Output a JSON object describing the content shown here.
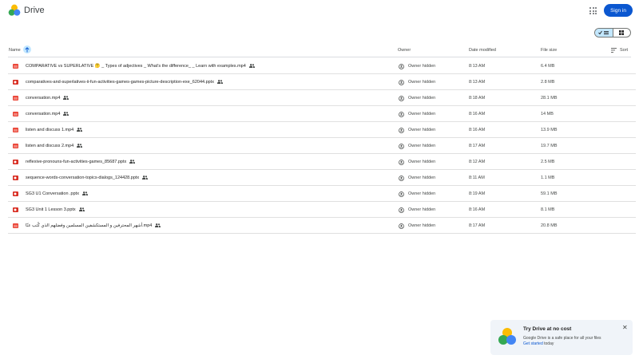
{
  "header": {
    "brand": "Drive",
    "signin_label": "Sign in"
  },
  "columns": {
    "name": "Name",
    "owner": "Owner",
    "date": "Date modified",
    "size": "File size",
    "sort": "Sort"
  },
  "files": [
    {
      "name": "COMPARATIVE vs SUPERLATIVE 🤔 _ Types of adjectives _ What's the difference_ _ Learn with examples.mp4",
      "type": "mp4",
      "owner": "Owner hidden",
      "date": "8:13 AM",
      "size": "6.4 MB"
    },
    {
      "name": "comparatives-and-superlatives-ii-fun-activities-games-games-picture-description-exe_62044.pptx",
      "type": "pptx",
      "owner": "Owner hidden",
      "date": "8:13 AM",
      "size": "2.8 MB"
    },
    {
      "name": "conversation.mp4",
      "type": "mp4",
      "owner": "Owner hidden",
      "date": "8:18 AM",
      "size": "28.1 MB"
    },
    {
      "name": "conversation.mp4",
      "type": "mp4",
      "owner": "Owner hidden",
      "date": "8:16 AM",
      "size": "14 MB"
    },
    {
      "name": "listen and discuss 1.mp4",
      "type": "mp4",
      "owner": "Owner hidden",
      "date": "8:16 AM",
      "size": "13.9 MB"
    },
    {
      "name": "listen and discuss 2.mp4",
      "type": "mp4",
      "owner": "Owner hidden",
      "date": "8:17 AM",
      "size": "19.7 MB"
    },
    {
      "name": "reflexive-pronouns-fun-activities-games_85687.pptx",
      "type": "pptx",
      "owner": "Owner hidden",
      "date": "8:12 AM",
      "size": "2.5 MB"
    },
    {
      "name": "sequence-words-conversation-topics-dialogs_124428.pptx",
      "type": "pptx",
      "owner": "Owner hidden",
      "date": "8:11 AM",
      "size": "1.1 MB"
    },
    {
      "name": "SG3 U1 Conversation .pptx",
      "type": "pptx",
      "owner": "Owner hidden",
      "date": "8:19 AM",
      "size": "59.1 MB"
    },
    {
      "name": "SG3 Unit 1 Lesson 3.pptx",
      "type": "pptx",
      "owner": "Owner hidden",
      "date": "8:16 AM",
      "size": "8.1 MB"
    },
    {
      "name": "أشهر المحترفين و المستكشفين  المسلمين وفضلهم الذي كُتب عنّا.mp4",
      "type": "mp4",
      "owner": "Owner hidden",
      "date": "8:17 AM",
      "size": "20.8 MB"
    }
  ],
  "promo": {
    "title": "Try Drive at no cost",
    "description": "Google Drive is a safe place for all your files",
    "link": "Get started",
    "link_suffix": " today"
  },
  "colors": {
    "accent": "#0b57d0",
    "selected": "#c2e7ff",
    "video": "#ea4335",
    "slides": "#d93025"
  }
}
